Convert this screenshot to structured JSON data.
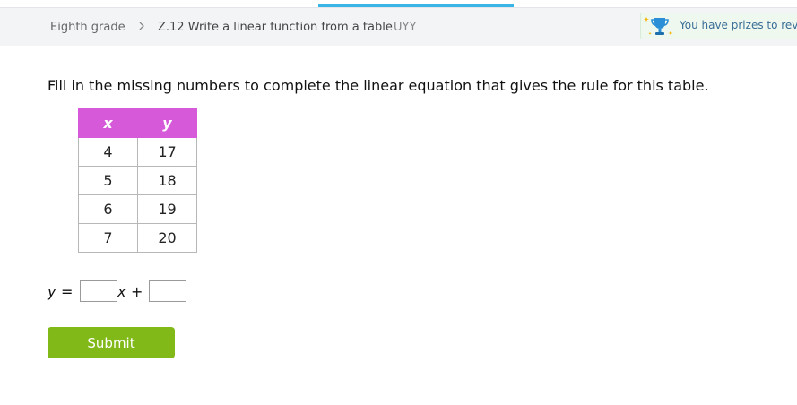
{
  "breadcrumb": {
    "grade": "Eighth grade",
    "skill": "Z.12 Write a linear function from a table",
    "code": "UYY"
  },
  "prize_banner": {
    "text": "You have prizes to reveal!",
    "icon": "trophy-icon"
  },
  "question": {
    "prompt": "Fill in the missing numbers to complete the linear equation that gives the rule for this table.",
    "table": {
      "headers": [
        "x",
        "y"
      ],
      "rows": [
        [
          "4",
          "17"
        ],
        [
          "5",
          "18"
        ],
        [
          "6",
          "19"
        ],
        [
          "7",
          "20"
        ]
      ]
    },
    "equation": {
      "y": "y",
      "equals": "=",
      "x": "x",
      "plus": "+"
    },
    "answers": {
      "slope": "",
      "intercept": ""
    }
  },
  "submit_label": "Submit",
  "colors": {
    "table_header": "#d559d8",
    "submit": "#80b918",
    "accent": "#38b4e7"
  }
}
